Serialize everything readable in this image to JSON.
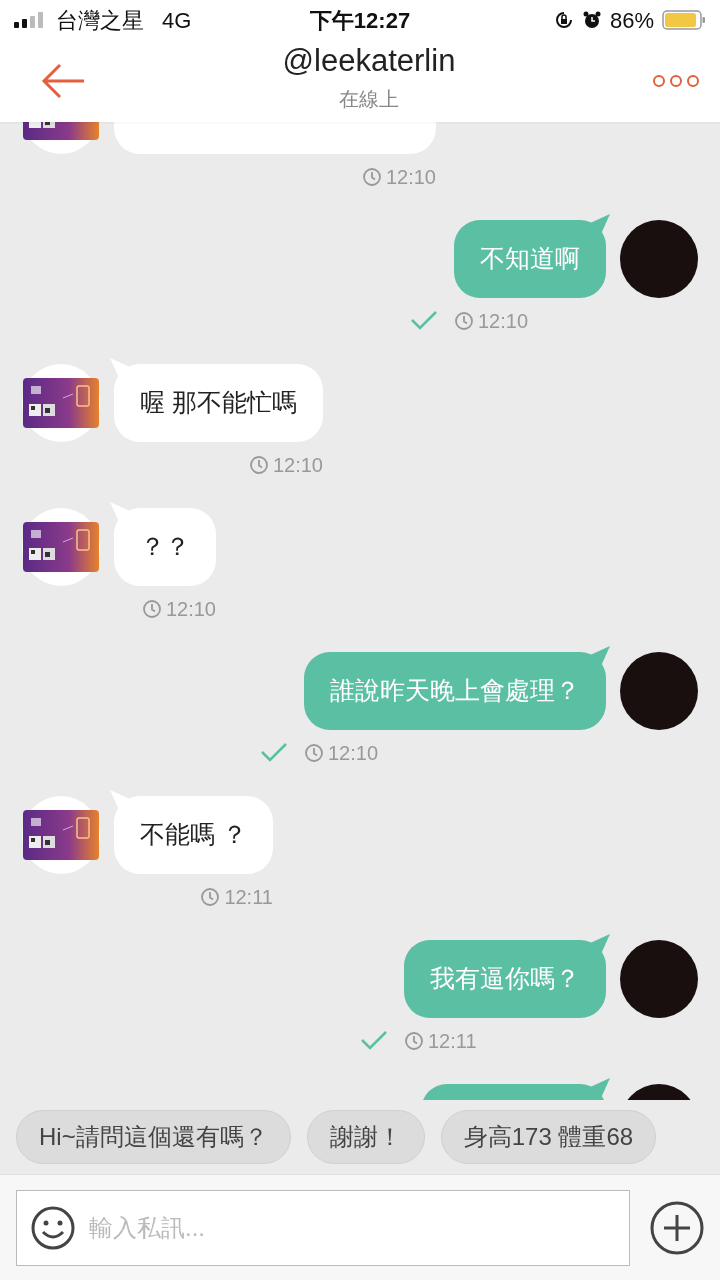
{
  "status_bar": {
    "carrier": "台灣之星",
    "network": "4G",
    "time": "下午12:27",
    "battery": "86%"
  },
  "header": {
    "title": "@leekaterlin",
    "subtitle": "在線上"
  },
  "messages": [
    {
      "kind": "incoming",
      "time": "12:10"
    },
    {
      "kind": "outgoing",
      "text": "不知道啊",
      "time": "12:10",
      "sent": true
    },
    {
      "kind": "incoming",
      "text": "喔 那不能忙嗎",
      "time": "12:10"
    },
    {
      "kind": "incoming",
      "text": "？？",
      "time": "12:10"
    },
    {
      "kind": "outgoing",
      "text": "誰說昨天晚上會處理？",
      "time": "12:10",
      "sent": true
    },
    {
      "kind": "incoming",
      "text": "不能嗎 ？",
      "time": "12:11"
    },
    {
      "kind": "outgoing",
      "text": "我有逼你嗎？",
      "time": "12:11",
      "sent": true
    },
    {
      "kind": "outgoing"
    }
  ],
  "quick_replies": [
    "Hi~請問這個還有嗎？",
    "謝謝！",
    "身高173 體重68"
  ],
  "composer": {
    "placeholder": "輸入私訊..."
  }
}
